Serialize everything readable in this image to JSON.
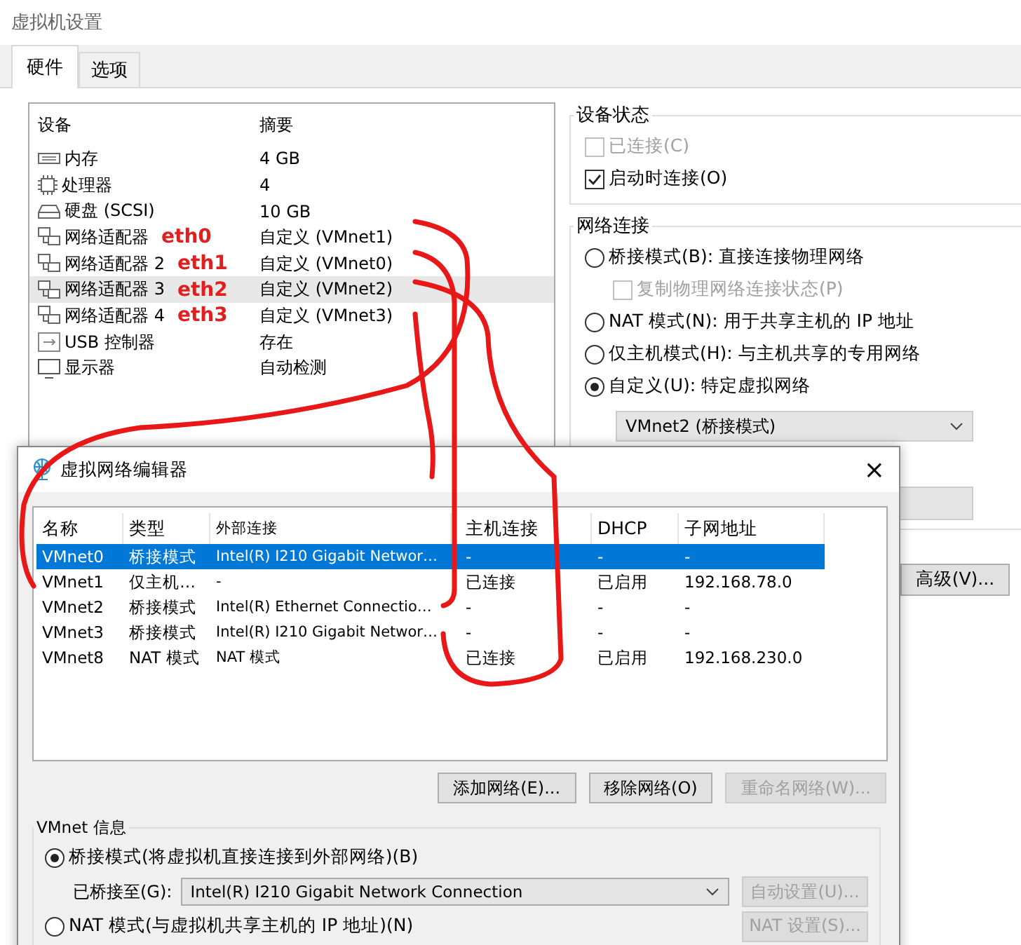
{
  "window": {
    "title": "虚拟机设置"
  },
  "tabs": [
    {
      "label": "硬件",
      "selected": true
    },
    {
      "label": "选项",
      "selected": false
    }
  ],
  "device_list": {
    "columns": [
      "设备",
      "摘要"
    ],
    "rows": [
      {
        "kind": "memory",
        "device": "内存",
        "summary": "4 GB",
        "selected": false
      },
      {
        "kind": "cpu",
        "device": "处理器",
        "summary": "4",
        "selected": false
      },
      {
        "kind": "disk",
        "device": "硬盘 (SCSI)",
        "summary": "10 GB",
        "selected": false
      },
      {
        "kind": "network",
        "device": "网络适配器",
        "annotation": "eth0",
        "summary": "自定义 (VMnet1)",
        "selected": false
      },
      {
        "kind": "network",
        "device": "网络适配器 2",
        "annotation": "eth1",
        "summary": "自定义 (VMnet0)",
        "selected": false
      },
      {
        "kind": "network",
        "device": "网络适配器 3",
        "annotation": "eth2",
        "summary": "自定义 (VMnet2)",
        "selected": true
      },
      {
        "kind": "network",
        "device": "网络适配器 4",
        "annotation": "eth3",
        "summary": "自定义 (VMnet3)",
        "selected": false
      },
      {
        "kind": "usb",
        "device": "USB 控制器",
        "summary": "存在",
        "selected": false
      },
      {
        "kind": "display",
        "device": "显示器",
        "summary": "自动检测",
        "selected": false
      }
    ]
  },
  "device_status": {
    "title": "设备状态",
    "options": [
      {
        "label": "已连接(C)",
        "checked": false,
        "disabled": true
      },
      {
        "label": "启动时连接(O)",
        "checked": true,
        "disabled": false
      }
    ]
  },
  "network_connection": {
    "title": "网络连接",
    "options": [
      {
        "kind": "radio",
        "label": "桥接模式(B): 直接连接物理网络",
        "selected": false
      },
      {
        "kind": "checkbox",
        "label": "复制物理网络连接状态(P)",
        "checked": false,
        "disabled": true
      },
      {
        "kind": "radio",
        "label": "NAT 模式(N): 用于共享主机的 IP 地址",
        "selected": false
      },
      {
        "kind": "radio",
        "label": "仅主机模式(H): 与主机共享的专用网络",
        "selected": false
      },
      {
        "kind": "radio",
        "label": "自定义(U): 特定虚拟网络",
        "selected": true
      }
    ],
    "dropdown": {
      "value": "VMnet2 (桥接模式)"
    }
  },
  "advanced_button": "高级(V)...",
  "editor": {
    "title": "虚拟网络编辑器",
    "close": "×",
    "columns": [
      "名称",
      "类型",
      "外部连接",
      "主机连接",
      "DHCP",
      "子网地址"
    ],
    "rows": [
      {
        "name": "VMnet0",
        "type": "桥接模式",
        "external": "Intel(R) I210 Gigabit Networ…",
        "host": "-",
        "dhcp": "-",
        "subnet": "-",
        "selected": true
      },
      {
        "name": "VMnet1",
        "type": "仅主机…",
        "external": "-",
        "host": "已连接",
        "dhcp": "已启用",
        "subnet": "192.168.78.0",
        "selected": false
      },
      {
        "name": "VMnet2",
        "type": "桥接模式",
        "external": "Intel(R) Ethernet Connectio…",
        "host": "-",
        "dhcp": "-",
        "subnet": "-",
        "selected": false
      },
      {
        "name": "VMnet3",
        "type": "桥接模式",
        "external": "Intel(R) I210 Gigabit Networ…",
        "host": "-",
        "dhcp": "-",
        "subnet": "-",
        "selected": false
      },
      {
        "name": "VMnet8",
        "type": "NAT 模式",
        "external": "NAT 模式",
        "host": "已连接",
        "dhcp": "已启用",
        "subnet": "192.168.230.0",
        "selected": false
      }
    ],
    "buttons": [
      {
        "label": "添加网络(E)...",
        "disabled": false
      },
      {
        "label": "移除网络(O)",
        "disabled": false
      },
      {
        "label": "重命名网络(W)...",
        "disabled": true
      }
    ],
    "info": {
      "title": "VMnet 信息",
      "bridge_radio": {
        "label": "桥接模式(将虚拟机直接连接到外部网络)(B)",
        "selected": true
      },
      "bridged_to_label": "已桥接至(G):",
      "bridged_to": "Intel(R) I210 Gigabit Network Connection",
      "auto_button": {
        "label": "自动设置(U)...",
        "disabled": true
      },
      "nat_radio": {
        "label": "NAT 模式(与虚拟机共享主机的 IP 地址)(N)",
        "selected": false
      },
      "nat_button": {
        "label": "NAT 设置(S)...",
        "disabled": true
      }
    }
  }
}
